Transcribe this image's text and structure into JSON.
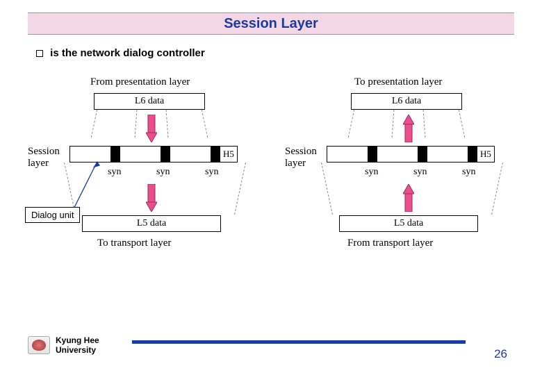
{
  "title": "Session Layer",
  "bullet_text": "is the network dialog controller",
  "diagram": {
    "from_presentation": "From presentation layer",
    "to_presentation": "To presentation layer",
    "l6_data": "L6 data",
    "session_layer_label": "Session\nlayer",
    "h5": "H5",
    "syn": "syn",
    "l5_data": "L5 data",
    "to_transport": "To transport layer",
    "from_transport": "From transport layer"
  },
  "annotation": "Dialog unit",
  "footer": {
    "university_line1": "Kyung Hee",
    "university_line2": "University",
    "page": "26"
  }
}
